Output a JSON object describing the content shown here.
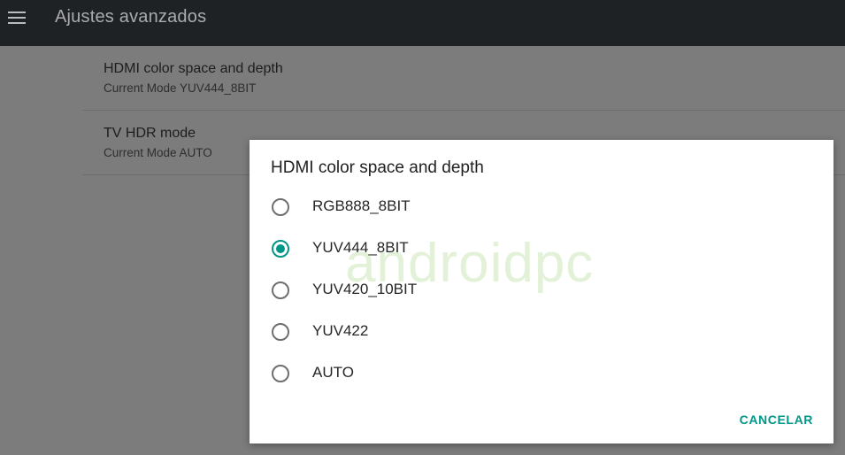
{
  "appbar": {
    "menu_icon": "hamburger-menu-icon",
    "title": "Ajustes avanzados"
  },
  "settings": {
    "items": [
      {
        "title": "HDMI color space and depth",
        "subtitle": "Current Mode YUV444_8BIT"
      },
      {
        "title": "TV HDR mode",
        "subtitle": "Current Mode AUTO"
      }
    ]
  },
  "dialog": {
    "title": "HDMI color space and depth",
    "selected": "YUV444_8BIT",
    "options": [
      {
        "label": "RGB888_8BIT"
      },
      {
        "label": "YUV444_8BIT"
      },
      {
        "label": "YUV420_10BIT"
      },
      {
        "label": "YUV422"
      },
      {
        "label": "AUTO"
      }
    ],
    "cancel_label": "CANCELAR"
  },
  "watermark": "androidpc",
  "colors": {
    "accent": "#009688",
    "appbar": "#1f2224",
    "scrim": "#7c7c7c"
  }
}
